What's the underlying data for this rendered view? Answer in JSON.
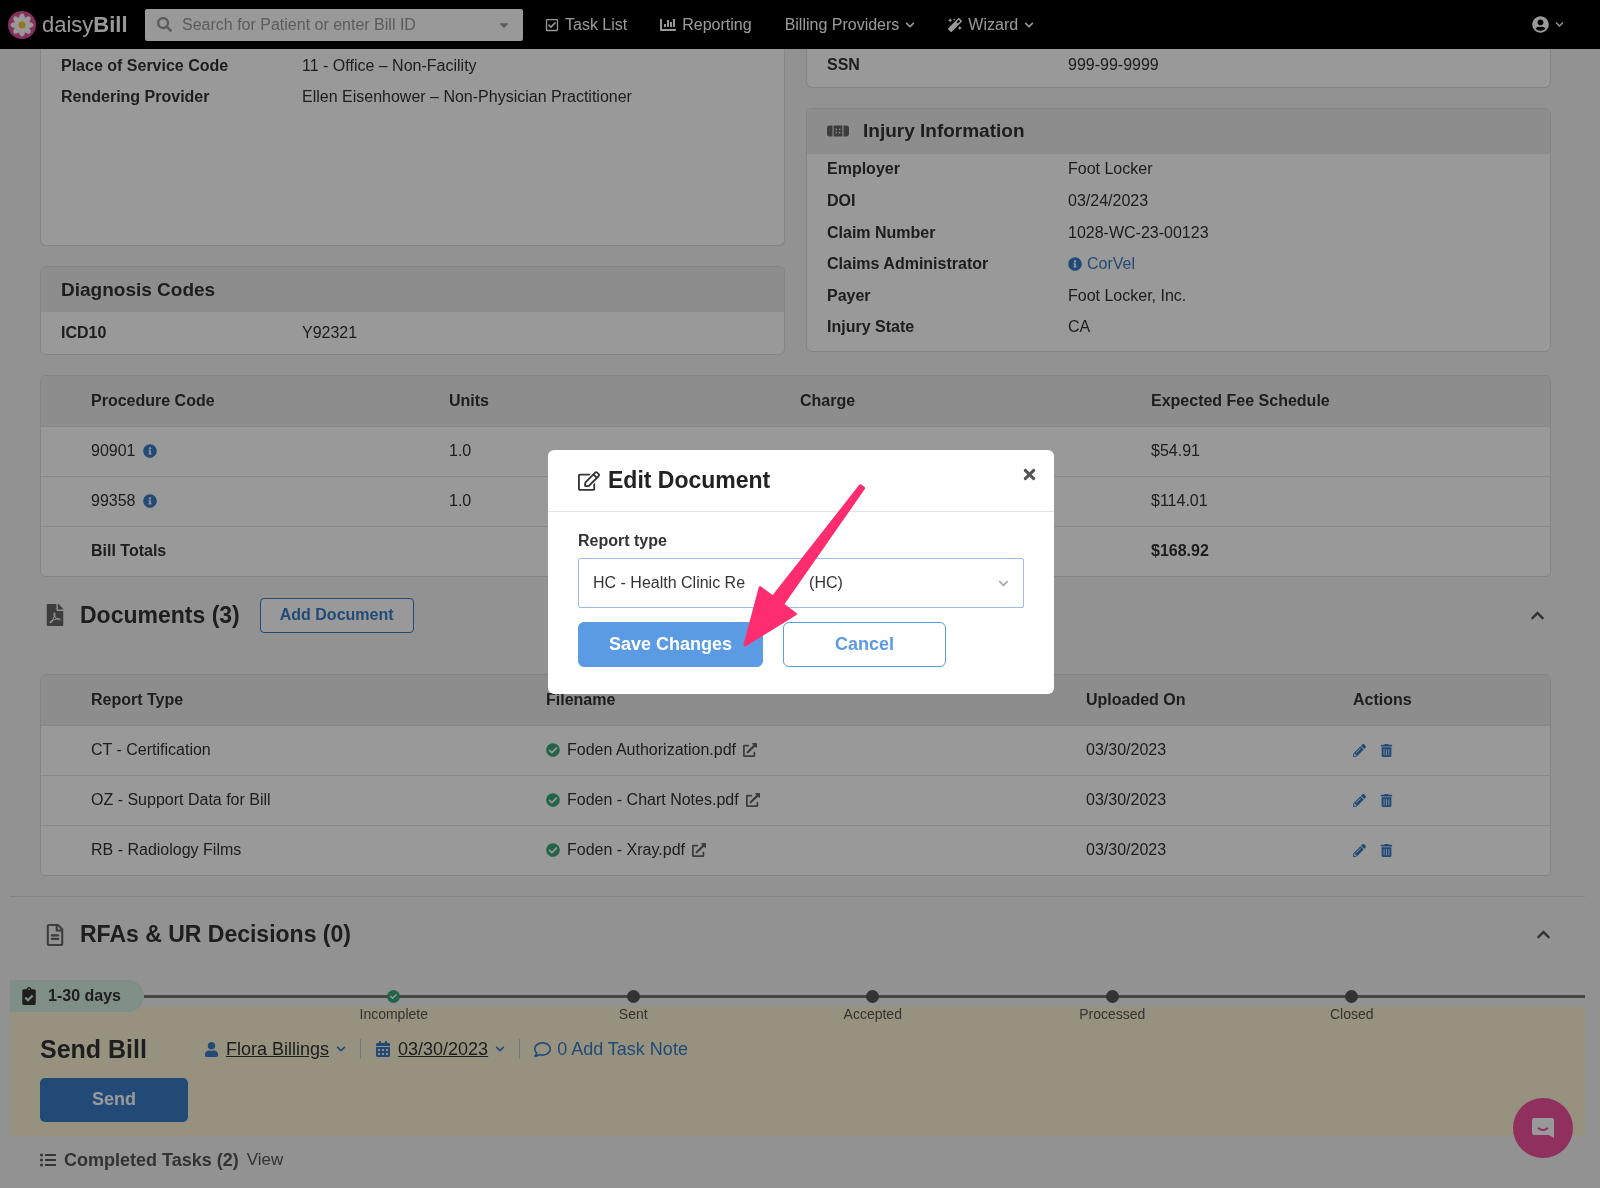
{
  "nav": {
    "logo": "daisy**Bill**",
    "search": {
      "placeholder": "Search for Patient or enter Bill ID"
    },
    "items": [
      {
        "label": "Task List",
        "kind": "tasks"
      },
      {
        "label": "Reporting",
        "kind": "chart"
      },
      {
        "label": "Billing Providers",
        "kind": "menu"
      },
      {
        "label": "Wizard",
        "kind": "wizard"
      }
    ]
  },
  "service_info": [
    {
      "label": "Place of Service Code",
      "value": "11 - Office – Non-Facility"
    },
    {
      "label": "Rendering Provider",
      "value": "Ellen Eisenhower – Non-Physician Practitioner"
    }
  ],
  "patient_info": [
    {
      "label": "SSN",
      "value": "999-99-9999"
    }
  ],
  "diagnosis": {
    "title": "Diagnosis Codes",
    "rows": [
      {
        "label": "ICD10",
        "value": "Y92321"
      }
    ]
  },
  "injury": {
    "title": "Injury Information",
    "rows": [
      {
        "label": "Employer",
        "value": "Foot Locker",
        "kind": "text"
      },
      {
        "label": "DOI",
        "value": "03/24/2023",
        "kind": "text"
      },
      {
        "label": "Claim Number",
        "value": "1028-WC-23-00123",
        "kind": "text"
      },
      {
        "label": "Claims Administrator",
        "value": "CorVel",
        "kind": "link"
      },
      {
        "label": "Payer",
        "value": "Foot Locker, Inc.",
        "kind": "text"
      },
      {
        "label": "Injury State",
        "value": "CA",
        "kind": "text"
      }
    ]
  },
  "procedures": {
    "columns": [
      "Procedure Code",
      "Units",
      "Charge",
      "Expected Fee Schedule"
    ],
    "rows": [
      {
        "code": "90901",
        "units": "1.0",
        "expected": "$54.91"
      },
      {
        "code": "99358",
        "units": "1.0",
        "expected": "$114.01"
      }
    ],
    "totals": {
      "label": "Bill Totals",
      "expected": "$168.92"
    }
  },
  "documents": {
    "title": "Documents (3)",
    "add_button": "Add Document",
    "expanded": true,
    "columns": [
      "Report Type",
      "Filename",
      "Uploaded On",
      "Actions"
    ],
    "rows": [
      {
        "type": "CT - Certification",
        "file": "Foden Authorization.pdf",
        "uploaded": "03/30/2023"
      },
      {
        "type": "OZ - Support Data for Bill",
        "file": "Foden - Chart Notes.pdf",
        "uploaded": "03/30/2023"
      },
      {
        "type": "RB - Radiology Films",
        "file": "Foden - Xray.pdf",
        "uploaded": "03/30/2023"
      }
    ]
  },
  "rfas": {
    "title": "RFAs & UR Decisions (0)",
    "expanded": true
  },
  "task": {
    "badge": "1-30 days",
    "steps": [
      {
        "label": "Incomplete",
        "done": true
      },
      {
        "label": "Sent",
        "done": false
      },
      {
        "label": "Accepted",
        "done": false
      },
      {
        "label": "Processed",
        "done": false
      },
      {
        "label": "Closed",
        "done": false
      }
    ],
    "title": "Send Bill",
    "assignee": "Flora Billings",
    "date": "03/30/2023",
    "note": "0 Add Task Note",
    "button": "Send"
  },
  "completed": {
    "label": "Completed Tasks (2)",
    "link": "View"
  },
  "modal": {
    "title": "Edit Document",
    "field_label": "Report type",
    "value": "HC - Health Clinic Re",
    "value_after_arrow": "(HC)",
    "buttons": [
      {
        "label": "Save Changes",
        "kind": "primary"
      },
      {
        "label": "Cancel",
        "kind": "secondary"
      }
    ]
  }
}
